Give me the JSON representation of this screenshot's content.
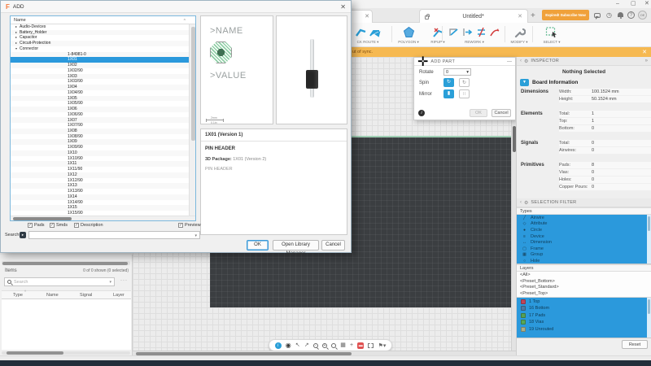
{
  "colors": {
    "accent": "#2a9fd8",
    "selection": "#2b99dc",
    "warning_bar": "#f6b951",
    "subscribe_orange": "#f0a13a",
    "board_dark": "#3b3e41",
    "navy_bar": "#232d3a"
  },
  "titlebar": {
    "tab_title": "Untitled*",
    "subscribe_label": "Expired! Subscribe Now",
    "avatar_initials": "OE"
  },
  "toolbar": {
    "groups": [
      {
        "label": "CK ROUTE ▾"
      },
      {
        "label": "POLYGON ▾"
      },
      {
        "label": "RIPUP ▾"
      },
      {
        "label": "REWORK ▾"
      },
      {
        "label": "MODIFY ▾"
      },
      {
        "label": "SELECT ▾"
      }
    ]
  },
  "warning": {
    "text": "ut of sync."
  },
  "dialog": {
    "title": "ADD",
    "tree": {
      "header": "Name",
      "rows": [
        {
          "label": "Audio-Devices",
          "level": 0
        },
        {
          "label": "Battery_Holder",
          "level": 0
        },
        {
          "label": "Capacitor",
          "level": 0
        },
        {
          "label": "Circuit-Protection",
          "level": 0
        },
        {
          "label": "Connector",
          "level": 0,
          "expanded": true
        },
        {
          "label": "1-84981-0",
          "level": 1
        },
        {
          "label": "1X01",
          "level": 1,
          "selected": true
        },
        {
          "label": "1X02",
          "level": 1
        },
        {
          "label": "1X02/90",
          "level": 1
        },
        {
          "label": "1X03",
          "level": 1
        },
        {
          "label": "1X03/90",
          "level": 1
        },
        {
          "label": "1X04",
          "level": 1
        },
        {
          "label": "1X04/90",
          "level": 1
        },
        {
          "label": "1X05",
          "level": 1
        },
        {
          "label": "1X05/90",
          "level": 1
        },
        {
          "label": "1X06",
          "level": 1
        },
        {
          "label": "1X06/90",
          "level": 1
        },
        {
          "label": "1X07",
          "level": 1
        },
        {
          "label": "1X07/90",
          "level": 1
        },
        {
          "label": "1X08",
          "level": 1
        },
        {
          "label": "1X08/90",
          "level": 1
        },
        {
          "label": "1X09",
          "level": 1
        },
        {
          "label": "1X09/90",
          "level": 1
        },
        {
          "label": "1X10",
          "level": 1
        },
        {
          "label": "1X10/90",
          "level": 1
        },
        {
          "label": "1X11",
          "level": 1
        },
        {
          "label": "1X11/90",
          "level": 1
        },
        {
          "label": "1X12",
          "level": 1
        },
        {
          "label": "1X12/90",
          "level": 1
        },
        {
          "label": "1X13",
          "level": 1
        },
        {
          "label": "1X13/90",
          "level": 1
        },
        {
          "label": "1X14",
          "level": 1
        },
        {
          "label": "1X14/90",
          "level": 1
        },
        {
          "label": "1X15",
          "level": 1
        },
        {
          "label": "1X15/90",
          "level": 1
        }
      ]
    },
    "footprint_preview": {
      "name_text": ">NAME",
      "value_text": ">VALUE",
      "scale_mm": "2mm",
      "scale_in": "0.1in"
    },
    "info": {
      "title": "1X01 (Version 1)",
      "headline": "PIN HEADER",
      "package_label": "3D Package:",
      "package_value": "1X01 (Version 2)",
      "package_desc": "PIN HEADER"
    },
    "checkboxes": [
      "Pads",
      "Smds",
      "Description",
      "Preview"
    ],
    "search_label": "Search",
    "buttons": {
      "ok": "OK",
      "library": "Open Library Manager",
      "cancel": "Cancel"
    }
  },
  "add_part": {
    "title": "ADD PART",
    "rotate_label": "Rotate",
    "rotate_value": "0",
    "spin_label": "Spin",
    "mirror_label": "Mirror",
    "ok": "OK",
    "cancel": "Cancel"
  },
  "inspector": {
    "title": "INSPECTOR",
    "nothing_selected": "Nothing Selected",
    "section": "Board Information",
    "groups": [
      {
        "name": "Dimensions",
        "rows": [
          [
            "Width:",
            "100.1524 mm"
          ],
          [
            "Height:",
            "50.1524 mm"
          ]
        ]
      },
      {
        "name": "Elements",
        "rows": [
          [
            "Total:",
            "1"
          ],
          [
            "Top:",
            "1"
          ],
          [
            "Bottom:",
            "0"
          ]
        ]
      },
      {
        "name": "Signals",
        "rows": [
          [
            "Total:",
            "0"
          ],
          [
            "Airwires:",
            "0"
          ]
        ]
      },
      {
        "name": "Primitives",
        "rows": [
          [
            "Pads:",
            "8"
          ],
          [
            "Vias:",
            "0"
          ],
          [
            "Holes:",
            "0"
          ],
          [
            "Copper Pours:",
            "0"
          ]
        ]
      }
    ]
  },
  "selection_filter": {
    "title": "SELECTION FILTER",
    "types_label": "Types",
    "types": [
      {
        "name": "Airwire",
        "icon": "╱"
      },
      {
        "name": "Attribute",
        "icon": "◇"
      },
      {
        "name": "Circle",
        "icon": "●"
      },
      {
        "name": "Device",
        "icon": "≡"
      },
      {
        "name": "Dimension",
        "icon": "↔"
      },
      {
        "name": "Frame",
        "icon": "▢"
      },
      {
        "name": "Group",
        "icon": "▦"
      },
      {
        "name": "Hole",
        "icon": "○"
      }
    ],
    "layers_label": "Layers",
    "presets": [
      "<All>",
      "<Preset_Bottom>",
      "<Preset_Standard>",
      "<Preset_Top>"
    ],
    "layers": [
      {
        "num": "1",
        "name": "Top",
        "color": "#c0455a"
      },
      {
        "num": "16",
        "name": "Bottom",
        "color": "#4a7ba6"
      },
      {
        "num": "17",
        "name": "Pads",
        "color": "#55a055"
      },
      {
        "num": "18",
        "name": "Vias",
        "color": "#58a758"
      },
      {
        "num": "19",
        "name": "Unrouted",
        "color": "#a8ad8a"
      }
    ],
    "reset": "Reset"
  },
  "items_panel": {
    "title": "Items",
    "count": "0 of 0 shown (0 selected)",
    "search_placeholder": "Search",
    "columns": [
      "Type",
      "Name",
      "Signal",
      "Layer"
    ]
  },
  "canvas_toolbar": {
    "icons": [
      "info",
      "visibility",
      "pan",
      "cursor",
      "zoom-out",
      "zoom-in",
      "zoom-fit",
      "grid",
      "crosshair",
      "stop",
      "select-box",
      "pin"
    ]
  }
}
